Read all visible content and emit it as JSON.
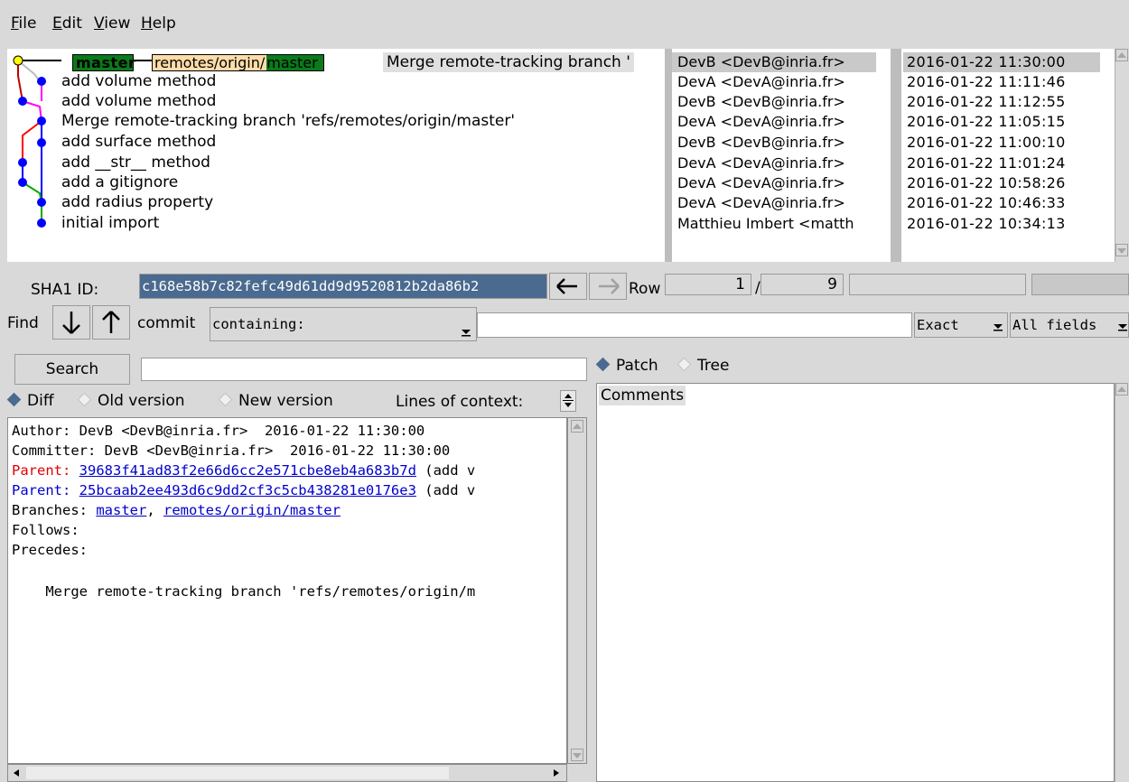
{
  "menu": [
    "File",
    "Edit",
    "View",
    "Help"
  ],
  "graph": {
    "branch_tag": "master",
    "remote_tag_prefix": "remotes/origin/",
    "remote_tag_suffix": "master",
    "headline": "Merge remote-tracking branch '",
    "commits": [
      "add volume method",
      "add volume method",
      "Merge remote-tracking branch 'refs/remotes/origin/master'",
      "add surface method",
      "add __str__ method",
      "add a gitignore",
      "add radius property",
      "initial import"
    ]
  },
  "authors": [
    "DevB <DevB@inria.fr>",
    "DevA <DevA@inria.fr>",
    "DevB <DevB@inria.fr>",
    "DevA <DevA@inria.fr>",
    "DevB <DevB@inria.fr>",
    "DevA <DevA@inria.fr>",
    "DevA <DevA@inria.fr>",
    "DevA <DevA@inria.fr>",
    "Matthieu Imbert <matth"
  ],
  "dates": [
    "2016-01-22 11:30:00",
    "2016-01-22 11:11:46",
    "2016-01-22 11:12:55",
    "2016-01-22 11:05:15",
    "2016-01-22 11:00:10",
    "2016-01-22 11:01:24",
    "2016-01-22 10:58:26",
    "2016-01-22 10:46:33",
    "2016-01-22 10:34:13"
  ],
  "sha": {
    "label": "SHA1 ID:",
    "value": "c168e58b7c82fefc49d61dd9d9520812b2da86b2",
    "row_label": "Row",
    "row_current": "1",
    "row_sep": "/",
    "row_total": "9"
  },
  "find": {
    "label": "Find",
    "commit_label": "commit",
    "containing": "containing:",
    "exact": "Exact",
    "all_fields": "All fields",
    "search_button": "Search"
  },
  "view": {
    "diff": "Diff",
    "old_version": "Old version",
    "new_version": "New version",
    "lines_of_context": "Lines of context:",
    "patch": "Patch",
    "tree": "Tree",
    "comments": "Comments"
  },
  "details": {
    "author": "Author: DevB <DevB@inria.fr>  2016-01-22 11:30:00",
    "committer": "Committer: DevB <DevB@inria.fr>  2016-01-22 11:30:00",
    "parent1_label": "Parent: ",
    "parent1_sha": "39683f41ad83f2e66d6cc2e571cbe8eb4a683b7d",
    "parent1_rest": " (add v",
    "parent2_label": "Parent: ",
    "parent2_sha": "25bcaab2ee493d6c9dd2cf3c5cb438281e0176e3",
    "parent2_rest": " (add v",
    "branches_label": "Branches: ",
    "branch1": "master",
    "branch_sep": ", ",
    "branch2": "remotes/origin/master",
    "follows": "Follows:",
    "precedes": "Precedes:",
    "message": "    Merge remote-tracking branch 'refs/remotes/origin/m"
  },
  "colors": {
    "tag_green": "#0a7a1a",
    "remote_tag": "#ffdca8",
    "sha_selected": "#4a6a90",
    "link_blue": "#0000cc",
    "parent_red": "#e00000",
    "graph_node": "#0000ff"
  }
}
